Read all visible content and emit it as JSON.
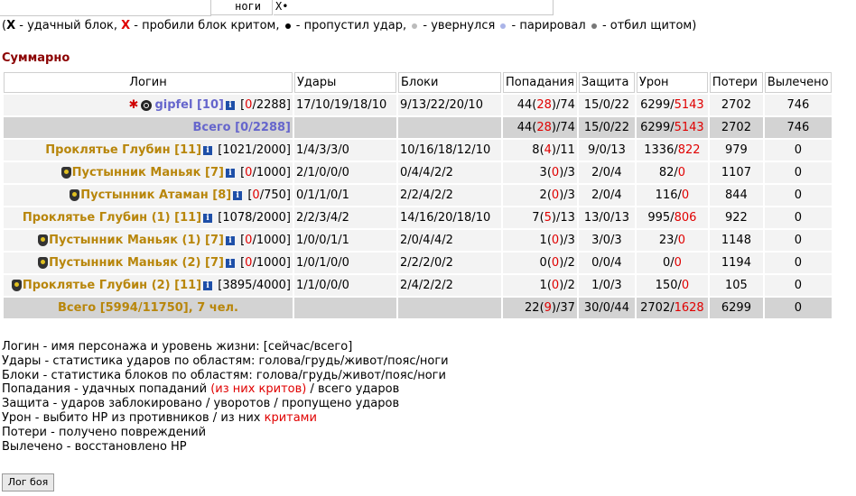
{
  "top_strip": {
    "label": "ноги",
    "value": "X•"
  },
  "legend": {
    "open": "(",
    "x_black": "X",
    "t1": " - удачный блок, ",
    "x_red": "X",
    "t2": " - пробили блок критом, ",
    "t3": " - пропустил удар, ",
    "t4": " - увернулся ",
    "t5": " - парировал ",
    "t6": " - отбил щитом)",
    "dot_colors": [
      "#000000",
      "#bbbbbb",
      "#aab4e8",
      "#777777"
    ]
  },
  "section_title": "Суммарно",
  "columns": [
    "Логин",
    "Удары",
    "Блоки",
    "Попадания",
    "Защита",
    "Урон",
    "Потери",
    "Вылечено"
  ],
  "rows": [
    {
      "name": "gipfel [10]",
      "hp_cur": "0",
      "hp_max": "2288",
      "hits": "17/10/19/18/10",
      "blocks": "9/13/22/20/10",
      "pop_a": "44",
      "pop_b": "28",
      "pop_c": "74",
      "def": "15/0/22",
      "dmg_a": "6299",
      "dmg_b": "5143",
      "loss": "2702",
      "heal": "746"
    },
    {
      "name": "Проклятье Глубин [11]",
      "hp_cur": "1021",
      "hp_max": "2000",
      "hits": "1/4/3/3/0",
      "blocks": "10/16/18/12/10",
      "pop_a": "8",
      "pop_b": "4",
      "pop_c": "11",
      "def": "9/0/13",
      "dmg_a": "1336",
      "dmg_b": "822",
      "loss": "979",
      "heal": "0"
    },
    {
      "name": "Пустынник Маньяк [7]",
      "hp_cur": "0",
      "hp_max": "1000",
      "hits": "2/1/0/0/0",
      "blocks": "0/4/4/2/2",
      "pop_a": "3",
      "pop_b": "0",
      "pop_c": "3",
      "def": "2/0/4",
      "dmg_a": "82",
      "dmg_b": "0",
      "loss": "1107",
      "heal": "0"
    },
    {
      "name": "Пустынник Атаман [8]",
      "hp_cur": "0",
      "hp_max": "750",
      "hits": "0/1/1/0/1",
      "blocks": "2/2/4/2/2",
      "pop_a": "2",
      "pop_b": "0",
      "pop_c": "3",
      "def": "2/0/4",
      "dmg_a": "116",
      "dmg_b": "0",
      "loss": "844",
      "heal": "0"
    },
    {
      "name": "Проклятье Глубин (1) [11]",
      "hp_cur": "1078",
      "hp_max": "2000",
      "hits": "2/2/3/4/2",
      "blocks": "14/16/20/18/10",
      "pop_a": "7",
      "pop_b": "5",
      "pop_c": "13",
      "def": "13/0/13",
      "dmg_a": "995",
      "dmg_b": "806",
      "loss": "922",
      "heal": "0"
    },
    {
      "name": "Пустынник Маньяк (1) [7]",
      "hp_cur": "0",
      "hp_max": "1000",
      "hits": "1/0/0/1/1",
      "blocks": "2/0/4/4/2",
      "pop_a": "1",
      "pop_b": "0",
      "pop_c": "3",
      "def": "3/0/3",
      "dmg_a": "23",
      "dmg_b": "0",
      "loss": "1148",
      "heal": "0"
    },
    {
      "name": "Пустынник Маньяк (2) [7]",
      "hp_cur": "0",
      "hp_max": "1000",
      "hits": "1/0/1/0/0",
      "blocks": "2/2/2/0/2",
      "pop_a": "0",
      "pop_b": "0",
      "pop_c": "2",
      "def": "0/0/4",
      "dmg_a": "0",
      "dmg_b": "0",
      "loss": "1194",
      "heal": "0"
    },
    {
      "name": "Проклятье Глубин (2) [11]",
      "hp_cur": "3895",
      "hp_max": "4000",
      "hits": "1/1/0/0/0",
      "blocks": "2/4/2/2/2",
      "pop_a": "1",
      "pop_b": "0",
      "pop_c": "2",
      "def": "1/0/3",
      "dmg_a": "150",
      "dmg_b": "0",
      "loss": "105",
      "heal": "0"
    }
  ],
  "total_a": {
    "label": "Всего [0/2288]",
    "pop_a": "44",
    "pop_b": "28",
    "pop_c": "74",
    "def": "15/0/22",
    "dmg_a": "6299",
    "dmg_b": "5143",
    "loss": "2702",
    "heal": "746"
  },
  "total_b": {
    "label": "Всего [5994/11750], 7 чел.",
    "pop_a": "22",
    "pop_b": "9",
    "pop_c": "37",
    "def": "30/0/44",
    "dmg_a": "2702",
    "dmg_b": "1628",
    "loss": "6299",
    "heal": "0"
  },
  "notes": {
    "n1": "Логин - имя персонажа и уровень жизни: [сейчас/всего]",
    "n2": "Удары - статистика ударов по областям: голова/грудь/живот/пояс/ноги",
    "n3": "Блоки - статистика блоков по областям: голова/грудь/живот/пояс/ноги",
    "n4a": "Попадания - удачных попаданий ",
    "n4b": "(из них критов)",
    "n4c": " / всего ударов",
    "n5": "Защита - ударов заблокировано / уворотов / пропущено ударов",
    "n6a": "Урон - выбито HP из противников / из них ",
    "n6b": "критами",
    "n7": "Потери - получено повреждений",
    "n8": "Вылечено - восстановлено HP"
  },
  "button": "Лог боя"
}
